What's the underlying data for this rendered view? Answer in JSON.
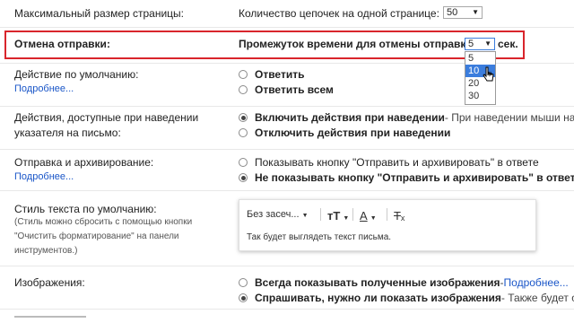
{
  "max_page_size": {
    "label": "Максимальный размер страницы:",
    "setting_label": "Количество цепочек на одной странице:",
    "value": "50"
  },
  "undo_send": {
    "label": "Отмена отправки:",
    "setting_label": "Промежуток времени для отмены отправки:",
    "value": "5",
    "unit": "сек.",
    "options": [
      "5",
      "10",
      "20",
      "30"
    ],
    "hovered_option": "10"
  },
  "default_action": {
    "label": "Действие по умолчанию:",
    "more": "Подробнее...",
    "options": [
      "Ответить",
      "Ответить всем"
    ]
  },
  "hover_actions": {
    "label_line1": "Действия, доступные при наведении",
    "label_line2": "указателя на письмо:",
    "option1": "Включить действия при наведении",
    "option1_desc": " - При наведении мыши на пис",
    "option2": "Отключить действия при наведении"
  },
  "send_archive": {
    "label": "Отправка и архивирование:",
    "more": "Подробнее...",
    "option1": "Показывать кнопку \"Отправить и архивировать\" в ответе",
    "option2": "Не показывать кнопку \"Отправить и архивировать\" в ответе"
  },
  "text_style": {
    "label": "Стиль текста по умолчанию:",
    "note_line1": "(Стиль можно сбросить с помощью кнопки",
    "note_line2": "\"Очистить форматирование\" на панели",
    "note_line3": "инструментов.)",
    "font": "Без засеч...",
    "preview": "Так будет выглядеть текст письма."
  },
  "images": {
    "label": "Изображения:",
    "option1": "Всегда показывать полученные изображения",
    "option1_sep": " - ",
    "option1_link": "Подробнее...",
    "option2": "Спрашивать, нужно ли показать изображения",
    "option2_desc": " - Также будет отк"
  },
  "colors": {
    "highlight": "#d9252c",
    "link": "#1a56c8",
    "dropdown_active": "#3b7ddd"
  }
}
